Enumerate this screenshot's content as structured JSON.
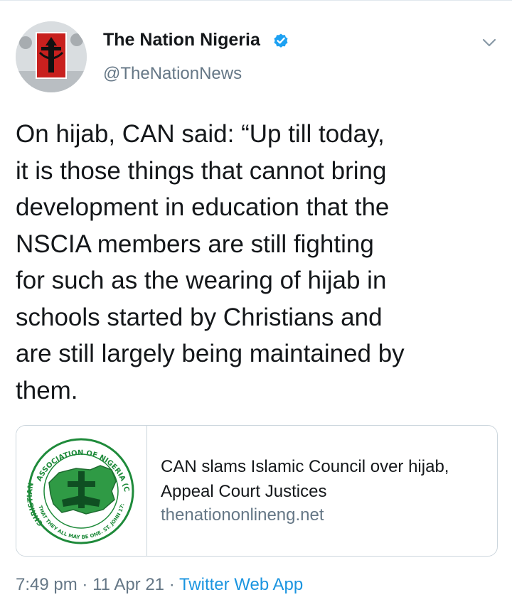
{
  "tweet": {
    "author": {
      "display_name": "The Nation Nigeria",
      "handle": "@TheNationNews",
      "verified": true,
      "avatar_icon": "the-nation-logo"
    },
    "menu_icon": "chevron-down-icon",
    "text": "On hijab, CAN said: “Up till today,\nit is those things that cannot bring\ndevelopment in education that the\nNSCIA members are still fighting\nfor such as the wearing of hijab in\nschools started by Christians and\nare still largely being maintained by\nthem.",
    "card": {
      "image_icon": "christian-association-of-nigeria-logo",
      "logo_text": {
        "top_arc": "ASSOCIATION OF NIGERIA (CAN)",
        "left_arc": "CHRISTIAN",
        "bottom_arc": "THAT THEY ALL MAY BE ONE. ST. JOHN 17:21"
      },
      "title": "CAN slams Islamic Council over hijab, Appeal Court Justices",
      "domain": "thenationonlineng.net"
    },
    "meta": {
      "time": "7:49 pm",
      "separator": "·",
      "date": "11 Apr 21",
      "source": "Twitter Web App"
    }
  },
  "colors": {
    "text": "#14171a",
    "secondary": "#657786",
    "link": "#1b95e0",
    "verified": "#1da1f2",
    "border": "#ccd6dd",
    "can_green": "#1e8a3a",
    "nation_red": "#c8201e"
  }
}
